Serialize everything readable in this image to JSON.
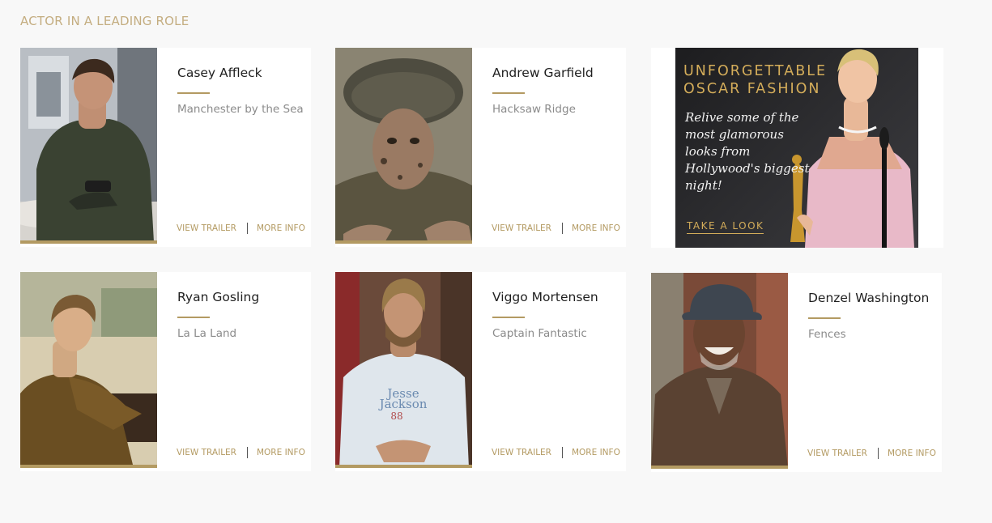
{
  "section": {
    "title": "ACTOR IN A LEADING ROLE"
  },
  "nominees": [
    {
      "name": "Casey Affleck",
      "film": "Manchester by the Sea",
      "trailer_label": "VIEW TRAILER",
      "info_label": "MORE INFO"
    },
    {
      "name": "Andrew Garfield",
      "film": "Hacksaw Ridge",
      "trailer_label": "VIEW TRAILER",
      "info_label": "MORE INFO"
    },
    {
      "name": "Ryan Gosling",
      "film": "La La Land",
      "trailer_label": "VIEW TRAILER",
      "info_label": "MORE INFO"
    },
    {
      "name": "Viggo Mortensen",
      "film": "Captain Fantastic",
      "trailer_label": "VIEW TRAILER",
      "info_label": "MORE INFO"
    },
    {
      "name": "Denzel Washington",
      "film": "Fences",
      "trailer_label": "VIEW TRAILER",
      "info_label": "MORE INFO"
    }
  ],
  "ad": {
    "headline_line1": "UNFORGETTABLE",
    "headline_line2": "OSCAR FASHION",
    "copy": "Relive some of the most glamorous looks from Hollywood's biggest night!",
    "cta": "TAKE A LOOK"
  },
  "colors": {
    "accent_gold": "#b39a62",
    "section_title": "#c4ad80",
    "background": "#f8f8f8"
  }
}
